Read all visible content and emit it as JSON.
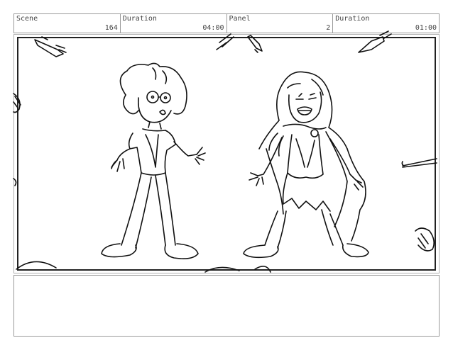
{
  "header": {
    "scene_label": "Scene",
    "scene_value": "164",
    "duration1_label": "Duration",
    "duration1_value": "04:00",
    "panel_label": "Panel",
    "panel_value": "2",
    "duration2_label": "Duration",
    "duration2_value": "01:00"
  },
  "panel": {
    "description": ""
  }
}
